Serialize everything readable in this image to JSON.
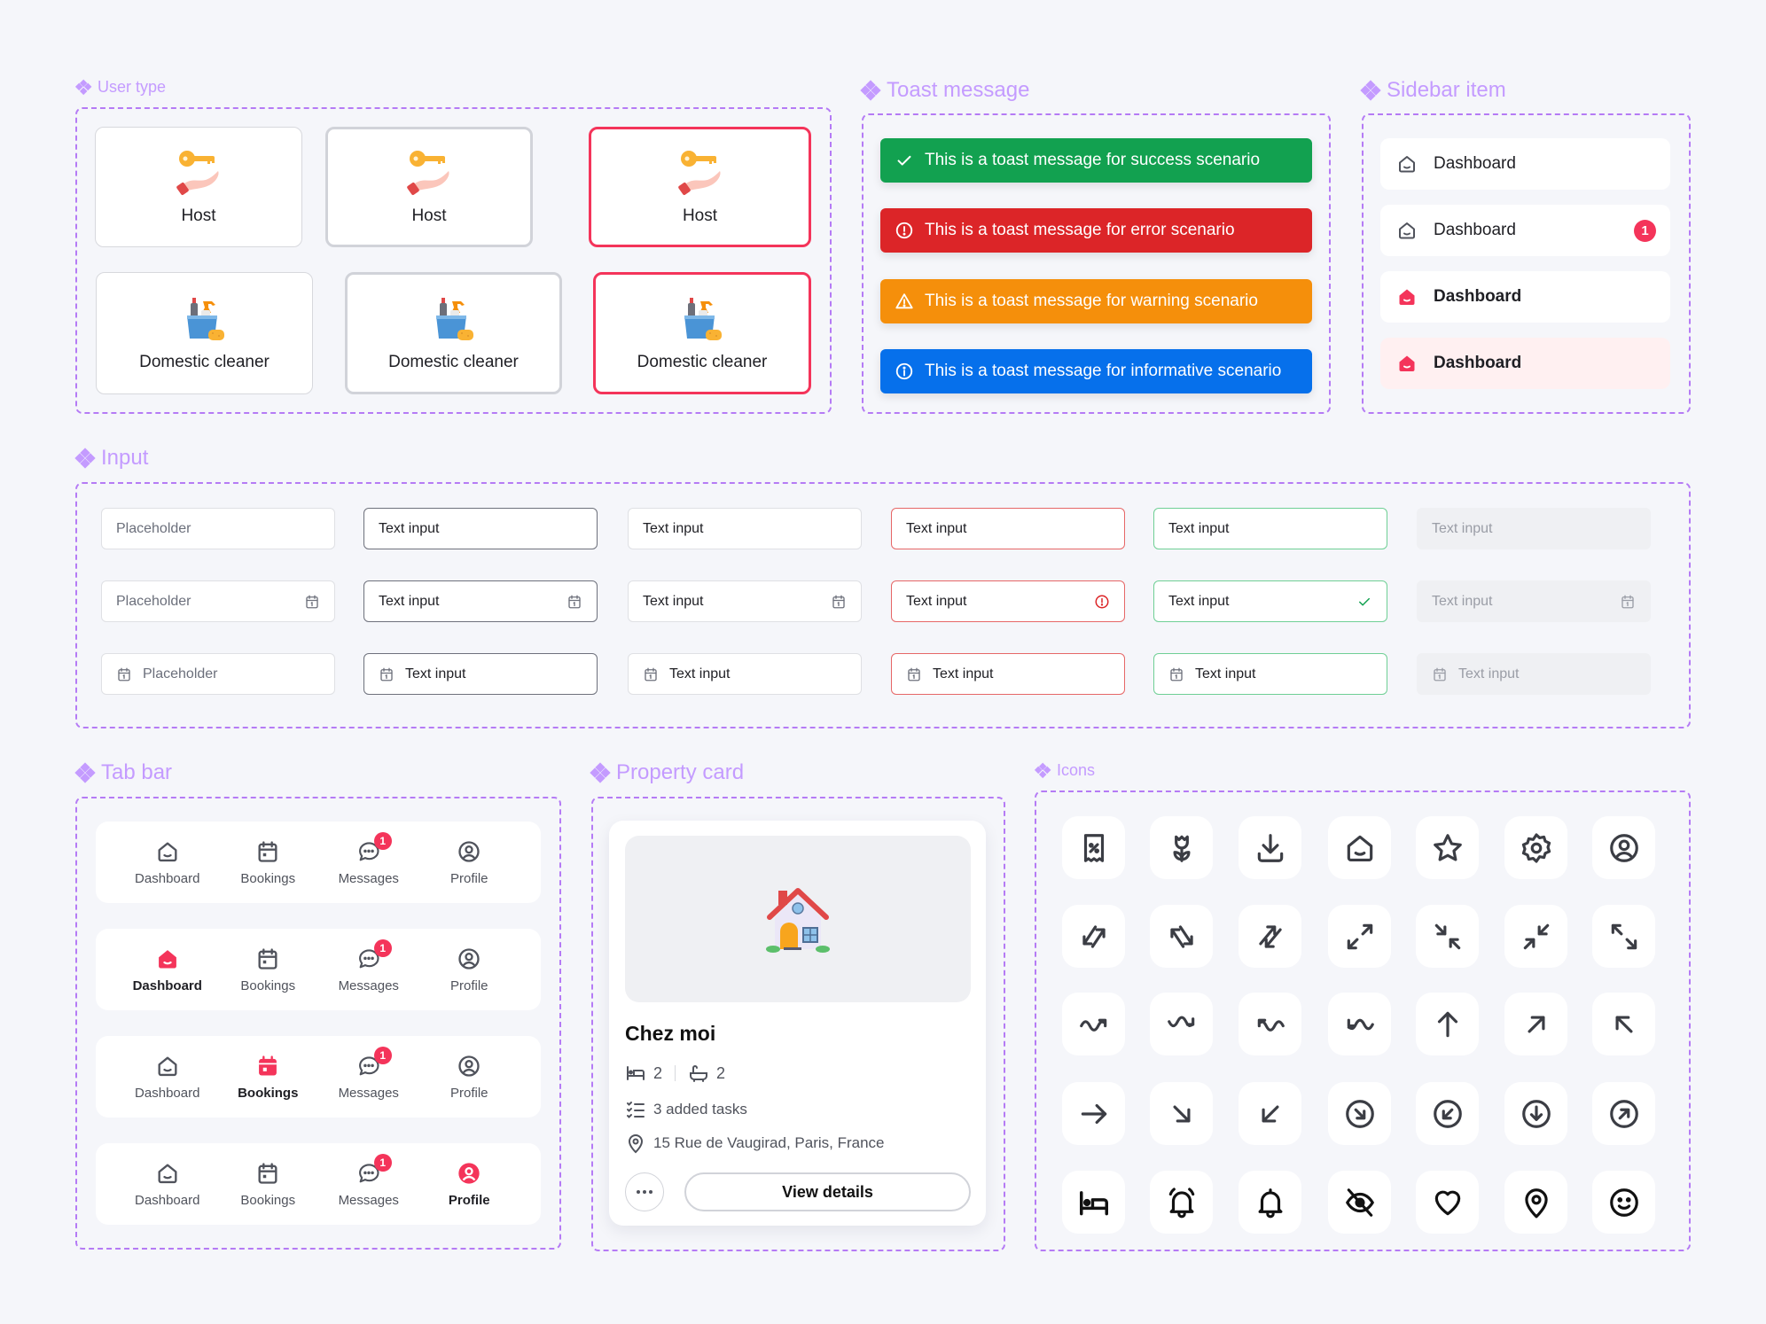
{
  "sections": {
    "user_type": "User type",
    "toast": "Toast message",
    "sidebar": "Sidebar item",
    "input": "Input",
    "tab_bar": "Tab bar",
    "property_card": "Property card",
    "icons": "Icons"
  },
  "colors": {
    "accent": "#f4345a",
    "section_label": "#c49bff",
    "frame_dash": "#b57bf5",
    "success": "#12a150",
    "error": "#dc2528",
    "warning": "#f58f0b",
    "info": "#0670eb",
    "background": "#f5f6fa"
  },
  "user_type": {
    "cards": [
      {
        "label": "Host",
        "icon": "key-hand-icon",
        "state": "default"
      },
      {
        "label": "Host",
        "icon": "key-hand-icon",
        "state": "hover"
      },
      {
        "label": "Host",
        "icon": "key-hand-icon",
        "state": "selected"
      },
      {
        "label": "Domestic cleaner",
        "icon": "cleaning-bucket-icon",
        "state": "default"
      },
      {
        "label": "Domestic cleaner",
        "icon": "cleaning-bucket-icon",
        "state": "hover"
      },
      {
        "label": "Domestic cleaner",
        "icon": "cleaning-bucket-icon",
        "state": "selected"
      }
    ]
  },
  "toasts": [
    {
      "type": "success",
      "icon": "check-icon",
      "message": "This is a toast message for success scenario"
    },
    {
      "type": "error",
      "icon": "error-circle-icon",
      "message": "This is a toast message for error scenario"
    },
    {
      "type": "warning",
      "icon": "warning-triangle-icon",
      "message": "This is a toast message for warning scenario"
    },
    {
      "type": "info",
      "icon": "info-circle-icon",
      "message": "This is a toast message for informative scenario"
    }
  ],
  "sidebar": {
    "items": [
      {
        "label": "Dashboard",
        "state": "default"
      },
      {
        "label": "Dashboard",
        "state": "notification",
        "badge": "1"
      },
      {
        "label": "Dashboard",
        "state": "active"
      },
      {
        "label": "Dashboard",
        "state": "active-highlighted"
      }
    ]
  },
  "inputs": {
    "columns": [
      {
        "state": "placeholder",
        "rows": [
          "Placeholder",
          "Placeholder",
          "Placeholder"
        ]
      },
      {
        "state": "focus",
        "rows": [
          "Text input",
          "Text input",
          "Text input"
        ]
      },
      {
        "state": "filled",
        "rows": [
          "Text input",
          "Text input",
          "Text input"
        ]
      },
      {
        "state": "error",
        "rows": [
          "Text input",
          "Text input",
          "Text input"
        ]
      },
      {
        "state": "success",
        "rows": [
          "Text input",
          "Text input",
          "Text input"
        ]
      },
      {
        "state": "disabled",
        "rows": [
          "Text input",
          "Text input",
          "Text input"
        ]
      }
    ]
  },
  "tab_bar": {
    "tabs": [
      "Dashboard",
      "Bookings",
      "Messages",
      "Profile"
    ],
    "message_badge": "1",
    "variants": [
      {
        "active": "none"
      },
      {
        "active": "Dashboard"
      },
      {
        "active": "Bookings"
      },
      {
        "active": "Profile"
      }
    ]
  },
  "property": {
    "title": "Chez moi",
    "bedrooms": "2",
    "bathrooms": "2",
    "tasks": "3 added tasks",
    "address": "15 Rue de Vaugirad, Paris, France",
    "view_details": "View details",
    "image_icon": "house-icon"
  },
  "icons": {
    "rows": [
      [
        "receipt-discount-icon",
        "tulip-icon",
        "download-icon",
        "home-icon",
        "star-icon",
        "settings-icon",
        "user-circle-icon"
      ],
      [
        "arrows-exchange-sw-ne-icon",
        "arrows-exchange-nw-se-icon",
        "arrows-exchange-ne-sw-icon",
        "expand-diagonal-icon",
        "collapse-nw-se-icon",
        "collapse-ne-sw-icon",
        "expand-nw-se-icon"
      ],
      [
        "wave-arrow-right-icon",
        "wave-arrow-right-2-icon",
        "wave-arrow-left-icon",
        "wave-arrow-left-2-icon",
        "arrow-up-icon",
        "arrow-up-right-icon",
        "arrow-up-left-icon"
      ],
      [
        "arrow-right-icon",
        "arrow-down-right-icon",
        "arrow-down-left-icon",
        "circle-arrow-down-right-icon",
        "circle-arrow-down-left-icon",
        "circle-arrow-down-icon",
        "circle-arrow-up-right-icon"
      ],
      [
        "bed-icon",
        "bell-ringing-icon",
        "bell-icon",
        "eye-off-icon",
        "heart-icon",
        "location-pin-icon",
        "smile-icon"
      ]
    ]
  }
}
